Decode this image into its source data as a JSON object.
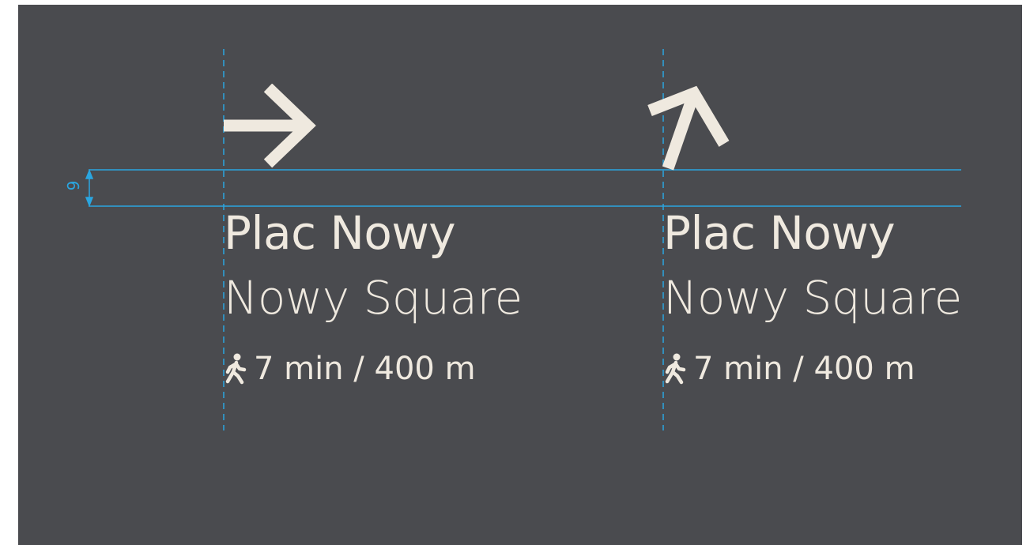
{
  "signs": [
    {
      "arrow": "arrow-right-icon",
      "title": "Plac Nowy",
      "subtitle": "Nowy Square",
      "walk_icon": "pedestrian-icon",
      "walk_text": "7 min / 400 m"
    },
    {
      "arrow": "arrow-up-right-icon",
      "title": "Plac Nowy",
      "subtitle": "Nowy Square",
      "walk_icon": "pedestrian-icon",
      "walk_text": "7 min / 400 m"
    }
  ],
  "dimension": {
    "label": "9"
  },
  "colors": {
    "background": "#4a4b4f",
    "sign_text": "#efe9df",
    "guide": "#2aa6e0"
  }
}
